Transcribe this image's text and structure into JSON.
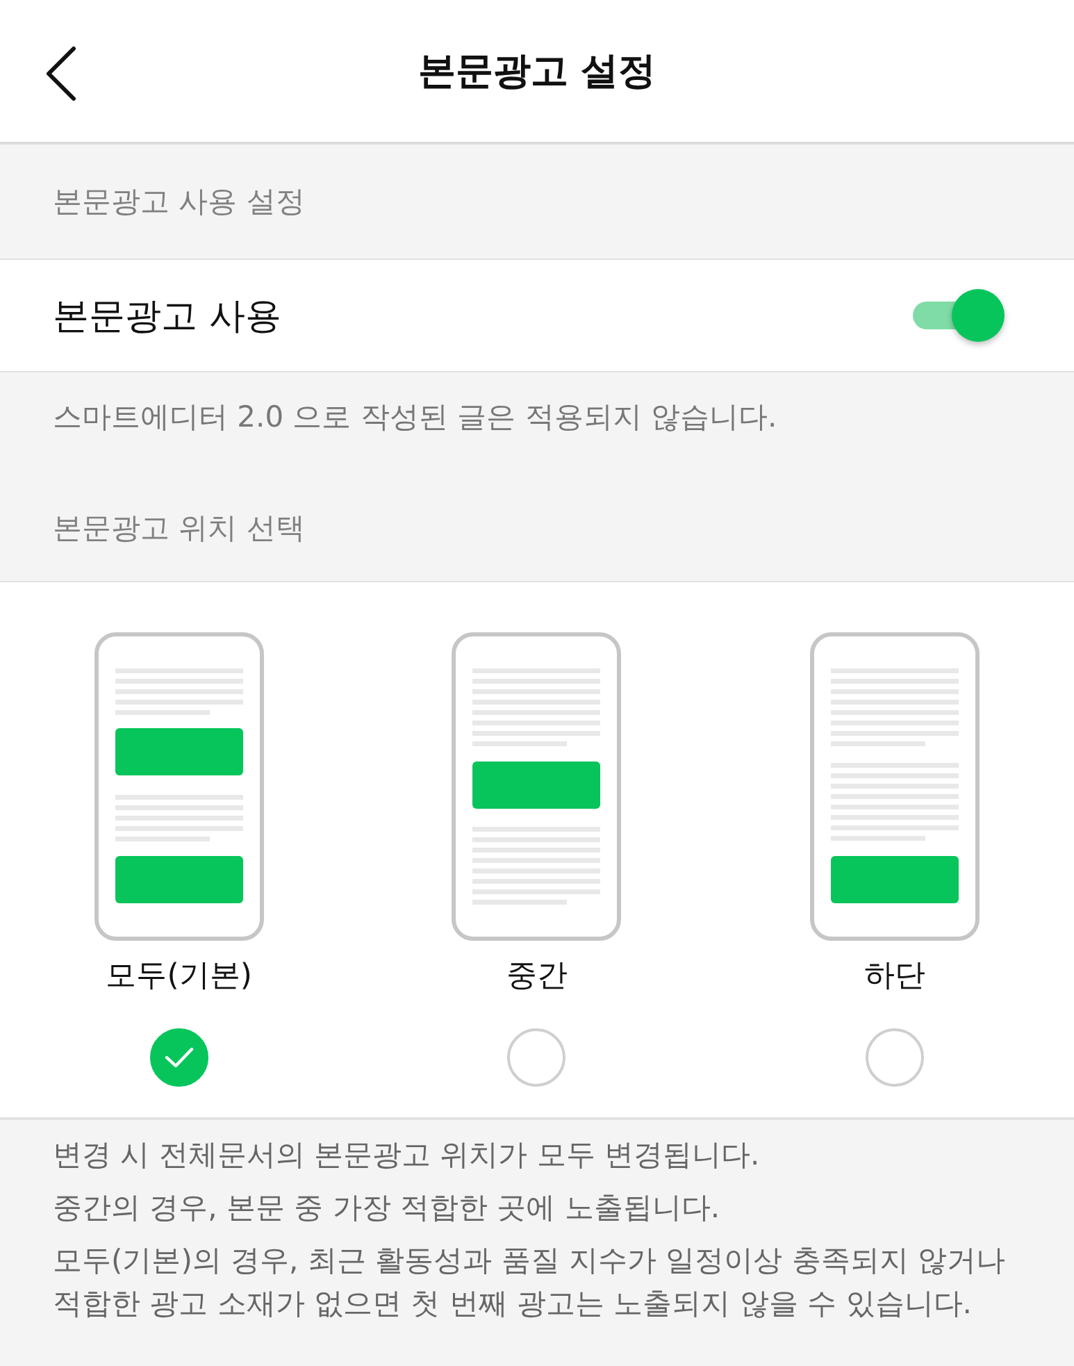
{
  "header": {
    "title": "본문광고 설정"
  },
  "usage_section": {
    "label": "본문광고 사용 설정",
    "setting": {
      "label": "본문광고 사용",
      "on": true
    },
    "note": "스마트에디터 2.0 으로 작성된 글은 적용되지 않습니다."
  },
  "position_section": {
    "label": "본문광고 위치 선택",
    "options": [
      {
        "kind": "all",
        "label": "모두(기본)",
        "selected": true
      },
      {
        "kind": "middle",
        "label": "중간",
        "selected": false
      },
      {
        "kind": "bottom",
        "label": "하단",
        "selected": false
      }
    ]
  },
  "notes": [
    "변경 시 전체문서의 본문광고 위치가 모두 변경됩니다.",
    "중간의 경우, 본문 중 가장 적합한 곳에 노출됩니다.",
    "모두(기본)의 경우, 최근 활동성과 품질 지수가 일정이상 충족되지 않거나 적합한 광고 소재가 없으면 첫 번째 광고는 노출되지 않을 수 있습니다."
  ]
}
